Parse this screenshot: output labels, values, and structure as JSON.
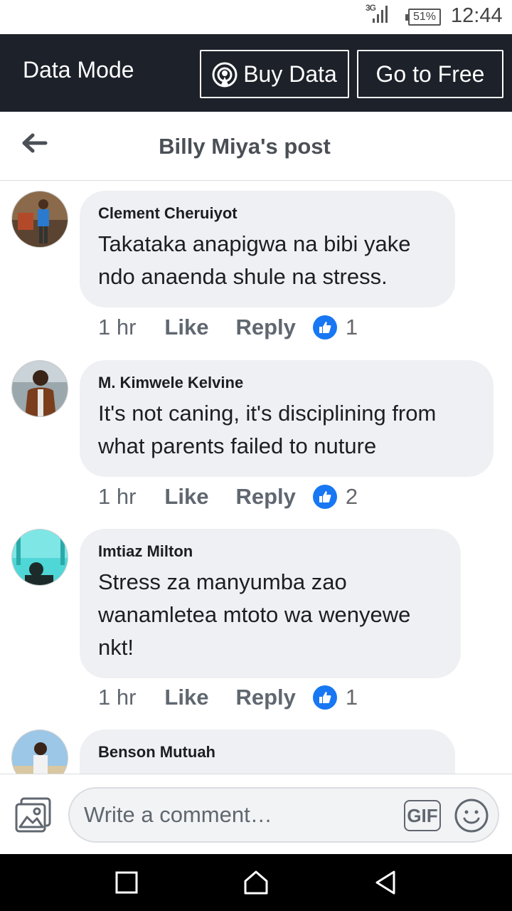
{
  "status_bar": {
    "network": "3G",
    "battery": "51%",
    "time": "12:44"
  },
  "data_bar": {
    "title": "Data Mode",
    "buy_label": "Buy Data",
    "free_label": "Go to Free"
  },
  "header": {
    "title": "Billy Miya's post"
  },
  "comments": [
    {
      "author": "Clement Cheruiyot",
      "line1": "Takataka anapigwa na bibi yake",
      "line2": "ndo anaenda shule na stress.",
      "line3": "",
      "time": "1 hr",
      "like": "Like",
      "reply": "Reply",
      "reactions": "1"
    },
    {
      "author": "M. Kimwele Kelvine",
      "line1": "It's not caning, it's disciplining from",
      "line2": "what parents failed to nuture",
      "line3": "",
      "time": "1 hr",
      "like": "Like",
      "reply": "Reply",
      "reactions": "2"
    },
    {
      "author": "Imtiaz Milton",
      "line1": "Stress za manyumba zao",
      "line2": "wanamletea mtoto wa wenyewe",
      "line3": "nkt!",
      "time": "1 hr",
      "like": "Like",
      "reply": "Reply",
      "reactions": "1"
    },
    {
      "author": "Benson Mutuah"
    }
  ],
  "composer": {
    "placeholder": "Write a comment…",
    "gif_label": "GIF"
  },
  "colors": {
    "data_bar_bg": "#1d2129",
    "bubble_bg": "#eef0f3",
    "like_blue": "#1877f2"
  },
  "icons": [
    "signal-icon",
    "battery-icon",
    "buy-data-icon",
    "back-arrow-icon",
    "like-reaction-icon",
    "photo-icon",
    "emoji-icon",
    "nav-recents-icon",
    "nav-home-icon",
    "nav-back-icon"
  ]
}
